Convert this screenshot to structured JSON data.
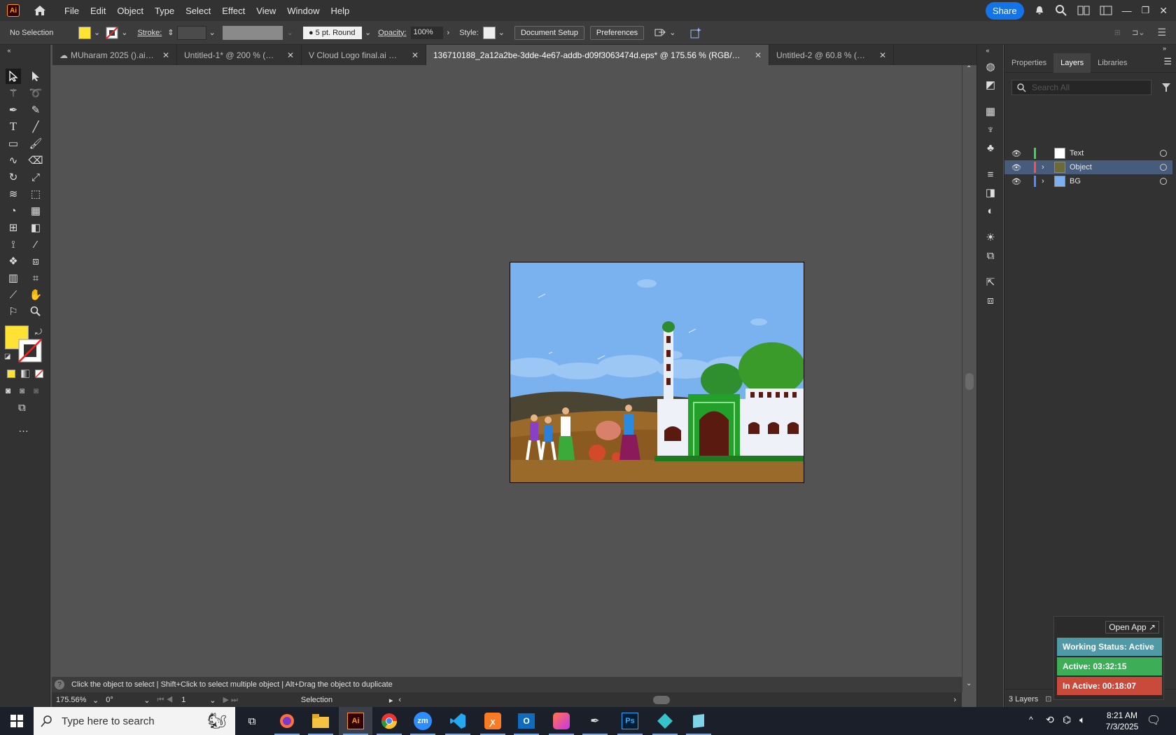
{
  "app": {
    "logo": "Ai"
  },
  "menu": [
    "File",
    "Edit",
    "Object",
    "Type",
    "Select",
    "Effect",
    "View",
    "Window",
    "Help"
  ],
  "topright": {
    "share": "Share"
  },
  "control": {
    "selection": "No Selection",
    "fill_color": "#ffe234",
    "stroke_label": "Stroke:",
    "brush": "5 pt. Round",
    "opacity_label": "Opacity:",
    "opacity": "100%",
    "style_label": "Style:",
    "doc_setup": "Document Setup",
    "preferences": "Preferences"
  },
  "tabs": [
    {
      "label": "MUharam 2025 ().aic @ ...",
      "active": false
    },
    {
      "label": "Untitled-1* @ 200 % (RGB/C...",
      "active": false
    },
    {
      "label": "V Cloud Logo final.ai @ 200 ...",
      "active": false
    },
    {
      "label": "136710188_2a12a2be-3dde-4e67-addb-d09f3063474d.eps* @ 175.56 % (RGB/CPU Preview)",
      "active": true
    },
    {
      "label": "Untitled-2 @ 60.8 % (CMYK/...",
      "active": false
    }
  ],
  "status": {
    "hint": "Click the object to select  |  Shift+Click to select multiple object  |  Alt+Drag the object to duplicate",
    "zoom": "175.56%",
    "rotation": "0°",
    "artboard": "1",
    "mode": "Selection"
  },
  "panel": {
    "tabs": [
      "Properties",
      "Layers",
      "Libraries"
    ],
    "search_placeholder": "Search All",
    "layers": [
      {
        "name": "Text",
        "color": "#3dd45a",
        "selected": false
      },
      {
        "name": "Object",
        "color": "#ff4d4d",
        "selected": true
      },
      {
        "name": "BG",
        "color": "#4d8dff",
        "selected": false
      }
    ],
    "footer": "3 Layers"
  },
  "widget": {
    "open": "Open App ↗",
    "working": "Working Status: Active",
    "active": "Active: 03:32:15",
    "inactive": "In Active: 00:18:07",
    "colors": {
      "working": "#4f9aa6",
      "active": "#3dae57",
      "inactive": "#c94a3b"
    }
  },
  "taskbar": {
    "search": "Type here to search",
    "time": "8:21 AM",
    "date": "7/3/2025"
  }
}
